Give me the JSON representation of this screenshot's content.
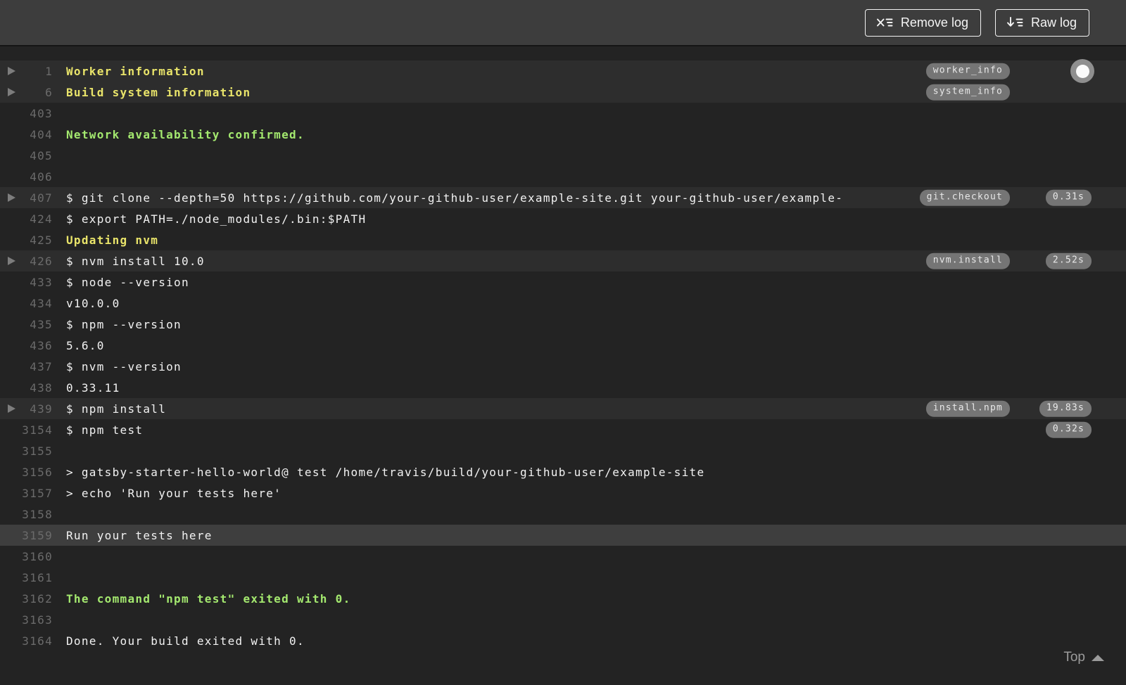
{
  "header": {
    "remove_log_label": "Remove log",
    "raw_log_label": "Raw log"
  },
  "footer": {
    "top_label": "Top"
  },
  "colors": {
    "toolbar_bg": "#3d3d3d",
    "log_bg": "#232323",
    "fold_row_bg": "#2d2d2d",
    "selected_row_bg": "#3e3e3e",
    "section_yellow": "#e9e46a",
    "success_green": "#a4e96f",
    "plain_text": "#f2f2f2",
    "line_number": "#6b6b6b",
    "pill_bg": "#757575"
  },
  "log": {
    "rows": [
      {
        "num": "1",
        "text": "Worker information",
        "style": "section",
        "fold": true,
        "bg": "fold",
        "tag": "worker_info"
      },
      {
        "num": "6",
        "text": "Build system information",
        "style": "section",
        "fold": true,
        "bg": "fold",
        "tag": "system_info"
      },
      {
        "num": "403",
        "text": ""
      },
      {
        "num": "404",
        "text": "Network availability confirmed.",
        "style": "success"
      },
      {
        "num": "405",
        "text": ""
      },
      {
        "num": "406",
        "text": ""
      },
      {
        "num": "407",
        "text": "$ git clone --depth=50 https://github.com/your-github-user/example-site.git your-github-user/example-",
        "fold": true,
        "bg": "fold",
        "tag": "git.checkout",
        "time": "0.31s"
      },
      {
        "num": "424",
        "text": "$ export PATH=./node_modules/.bin:$PATH"
      },
      {
        "num": "425",
        "text": "Updating nvm",
        "style": "section"
      },
      {
        "num": "426",
        "text": "$ nvm install 10.0",
        "fold": true,
        "bg": "fold",
        "tag": "nvm.install",
        "time": "2.52s"
      },
      {
        "num": "433",
        "text": "$ node --version"
      },
      {
        "num": "434",
        "text": "v10.0.0"
      },
      {
        "num": "435",
        "text": "$ npm --version"
      },
      {
        "num": "436",
        "text": "5.6.0"
      },
      {
        "num": "437",
        "text": "$ nvm --version"
      },
      {
        "num": "438",
        "text": "0.33.11"
      },
      {
        "num": "439",
        "text": "$ npm install",
        "fold": true,
        "bg": "fold",
        "tag": "install.npm",
        "time": "19.83s"
      },
      {
        "num": "3154",
        "text": "$ npm test",
        "time": "0.32s"
      },
      {
        "num": "3155",
        "text": ""
      },
      {
        "num": "3156",
        "text": "> gatsby-starter-hello-world@ test /home/travis/build/your-github-user/example-site"
      },
      {
        "num": "3157",
        "text": "> echo 'Run your tests here'"
      },
      {
        "num": "3158",
        "text": ""
      },
      {
        "num": "3159",
        "text": "Run your tests here",
        "bg": "selected"
      },
      {
        "num": "3160",
        "text": ""
      },
      {
        "num": "3161",
        "text": ""
      },
      {
        "num": "3162",
        "text": "The command \"npm test\" exited with 0.",
        "style": "success"
      },
      {
        "num": "3163",
        "text": ""
      },
      {
        "num": "3164",
        "text": "Done. Your build exited with 0."
      }
    ]
  }
}
